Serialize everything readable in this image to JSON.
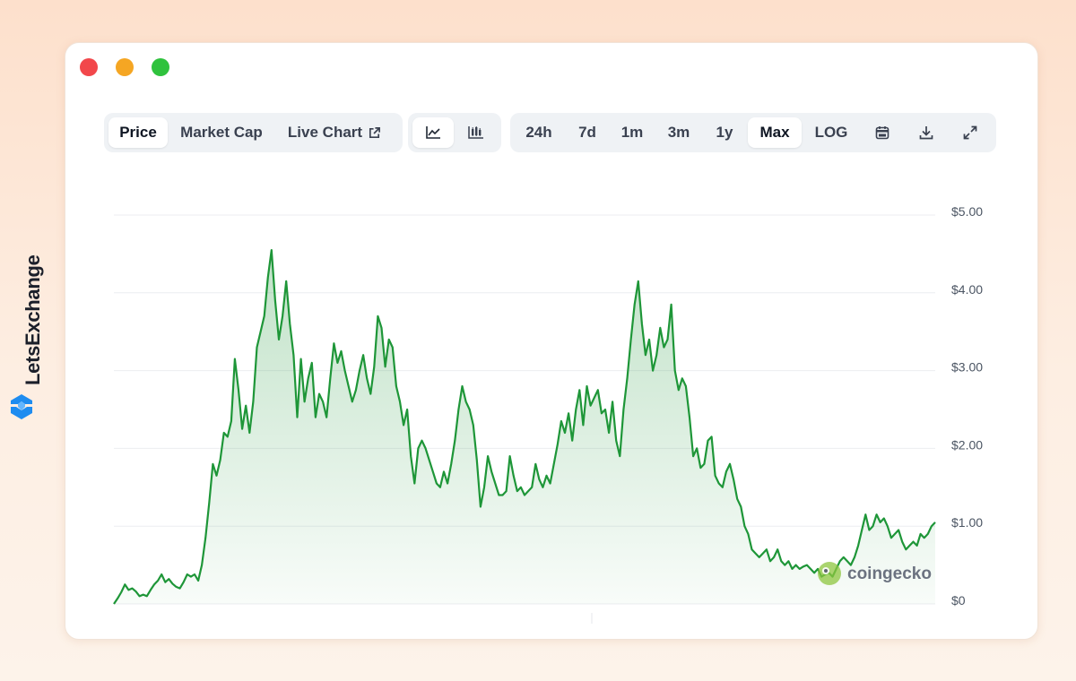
{
  "brand": {
    "name": "LetsExchange"
  },
  "tabs": {
    "price": "Price",
    "market_cap": "Market Cap",
    "live_chart": "Live Chart"
  },
  "ranges": [
    "24h",
    "7d",
    "1m",
    "3m",
    "1y",
    "Max",
    "LOG"
  ],
  "active_range": "Max",
  "watermark": "coingecko",
  "chart_data": {
    "type": "area",
    "y_ticks": [
      "$0",
      "$1.00",
      "$2.00",
      "$3.00",
      "$4.00",
      "$5.00"
    ],
    "ylim": [
      0,
      5
    ],
    "grid": true,
    "line_color": "#1e9638",
    "fill_color": "#1e9638",
    "series": [
      {
        "values": [
          0.0,
          0.07,
          0.15,
          0.25,
          0.18,
          0.2,
          0.16,
          0.1,
          0.12,
          0.1,
          0.18,
          0.25,
          0.3,
          0.38,
          0.28,
          0.32,
          0.26,
          0.22,
          0.2,
          0.28,
          0.38,
          0.35,
          0.38,
          0.3,
          0.5,
          0.85,
          1.3,
          1.8,
          1.65,
          1.85,
          2.2,
          2.15,
          2.35,
          3.15,
          2.75,
          2.25,
          2.55,
          2.2,
          2.6,
          3.3,
          3.5,
          3.7,
          4.2,
          4.55,
          3.9,
          3.4,
          3.7,
          4.15,
          3.6,
          3.2,
          2.4,
          3.15,
          2.6,
          2.9,
          3.1,
          2.4,
          2.7,
          2.6,
          2.4,
          2.9,
          3.35,
          3.1,
          3.25,
          3.0,
          2.8,
          2.6,
          2.75,
          3.0,
          3.2,
          2.9,
          2.7,
          3.05,
          3.7,
          3.55,
          3.05,
          3.4,
          3.3,
          2.8,
          2.6,
          2.3,
          2.5,
          1.9,
          1.55,
          2.0,
          2.1,
          2.0,
          1.85,
          1.7,
          1.55,
          1.5,
          1.7,
          1.55,
          1.8,
          2.1,
          2.5,
          2.8,
          2.6,
          2.5,
          2.3,
          1.85,
          1.25,
          1.5,
          1.9,
          1.7,
          1.55,
          1.4,
          1.4,
          1.45,
          1.9,
          1.65,
          1.45,
          1.5,
          1.4,
          1.45,
          1.5,
          1.8,
          1.6,
          1.5,
          1.65,
          1.55,
          1.8,
          2.05,
          2.35,
          2.2,
          2.45,
          2.1,
          2.5,
          2.75,
          2.3,
          2.8,
          2.55,
          2.65,
          2.75,
          2.45,
          2.5,
          2.2,
          2.6,
          2.1,
          1.9,
          2.5,
          2.9,
          3.4,
          3.85,
          4.15,
          3.6,
          3.2,
          3.4,
          3.0,
          3.2,
          3.55,
          3.3,
          3.4,
          3.85,
          3.0,
          2.75,
          2.9,
          2.8,
          2.4,
          1.9,
          2.0,
          1.75,
          1.8,
          2.1,
          2.15,
          1.65,
          1.55,
          1.5,
          1.7,
          1.8,
          1.6,
          1.35,
          1.25,
          1.0,
          0.9,
          0.7,
          0.65,
          0.6,
          0.65,
          0.7,
          0.55,
          0.6,
          0.7,
          0.55,
          0.5,
          0.55,
          0.45,
          0.5,
          0.45,
          0.48,
          0.5,
          0.45,
          0.4,
          0.45,
          0.35,
          0.38,
          0.4,
          0.35,
          0.45,
          0.55,
          0.6,
          0.55,
          0.5,
          0.6,
          0.75,
          0.95,
          1.15,
          0.95,
          1.0,
          1.15,
          1.05,
          1.1,
          1.0,
          0.85,
          0.9,
          0.95,
          0.8,
          0.7,
          0.75,
          0.8,
          0.75,
          0.9,
          0.85,
          0.9,
          1.0,
          1.05
        ]
      }
    ]
  }
}
